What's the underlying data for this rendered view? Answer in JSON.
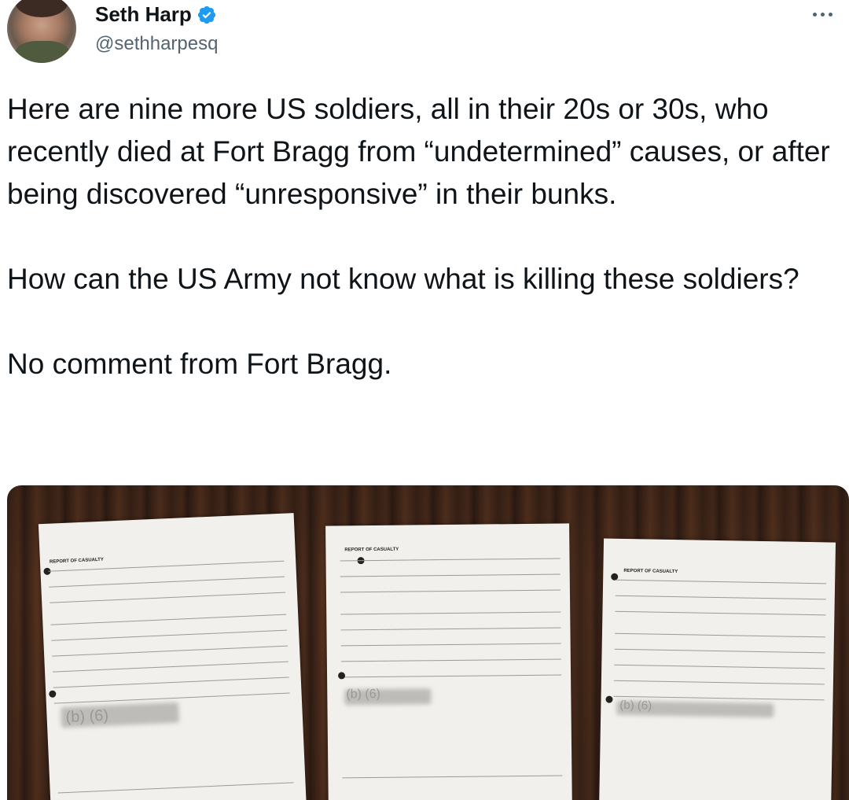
{
  "author": {
    "display_name": "Seth Harp",
    "handle": "@sethharpesq",
    "verified": true,
    "avatar_icon": "profile-photo"
  },
  "tweet": {
    "paragraph1": "Here are nine more US soldiers, all in their 20s or 30s, who recently died at Fort Bragg from “undetermined” causes, or after being discovered “unresponsive” in their bunks.",
    "paragraph2": "How can the US Army not know what is killing these soldiers?",
    "paragraph3": "No comment from Fort Bragg."
  },
  "media": {
    "documents": [
      {
        "title": "REPORT OF CASUALTY",
        "redacted": "(b) (6)"
      },
      {
        "title": "REPORT OF CASUALTY",
        "redacted": "(b) (6)"
      },
      {
        "title": "REPORT OF CASUALTY",
        "redacted": "(b) (6)"
      }
    ]
  },
  "colors": {
    "text": "#0f1419",
    "secondary": "#536471",
    "verified": "#1d9bf0"
  }
}
